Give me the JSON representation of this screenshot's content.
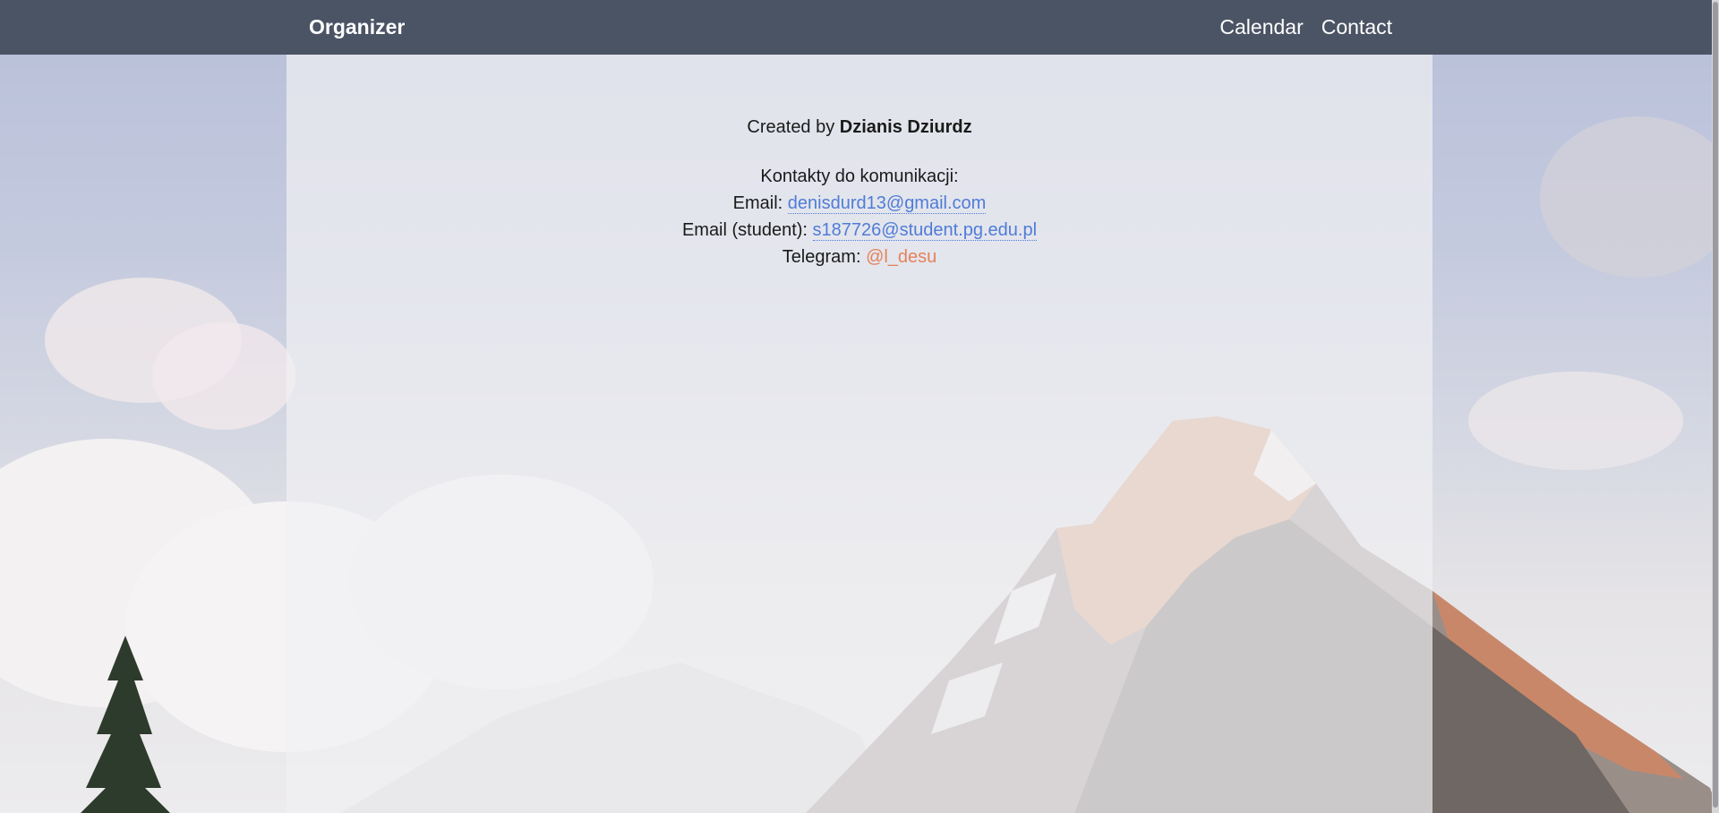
{
  "navbar": {
    "brand": "Organizer",
    "links": [
      {
        "label": "Calendar"
      },
      {
        "label": "Contact"
      }
    ]
  },
  "contact": {
    "created_by_prefix": "Created by ",
    "author": "Dzianis Dziurdz",
    "heading": "Kontakty do komunikacji:",
    "email_label": "Email: ",
    "email_value": "denisdurd13@gmail.com",
    "student_email_label": "Email (student): ",
    "student_email_value": "s187726@student.pg.edu.pl",
    "telegram_label": "Telegram: ",
    "telegram_value": "@l_desu"
  },
  "colors": {
    "navbar_bg": "#4a5464",
    "email_link": "#4f7cd6",
    "telegram_link": "#e4825c"
  },
  "background": {
    "image": "mountain-landscape"
  }
}
